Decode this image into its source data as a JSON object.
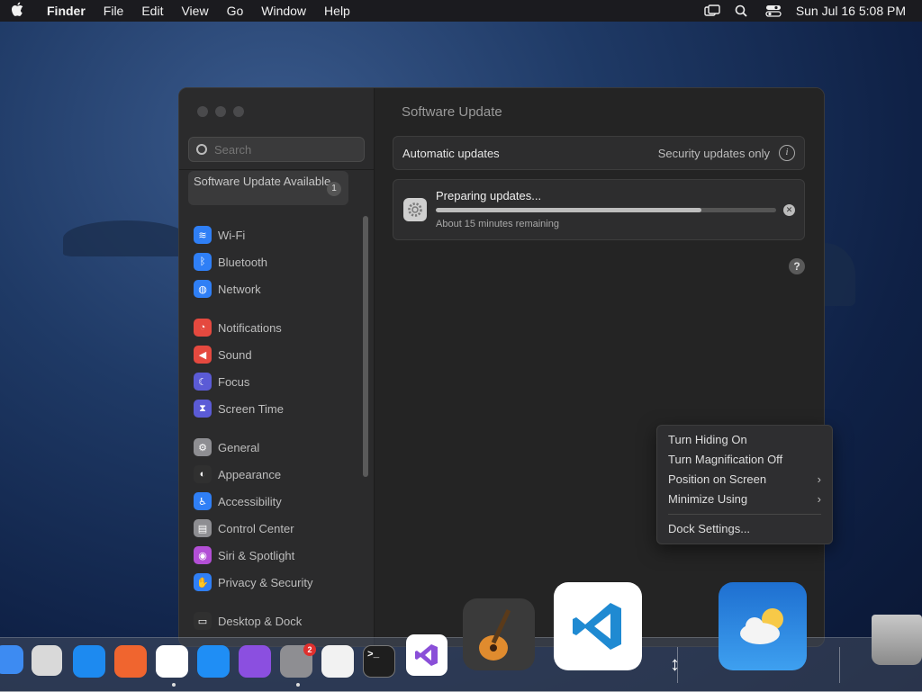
{
  "menubar": {
    "app_name": "Finder",
    "items": [
      "File",
      "Edit",
      "View",
      "Go",
      "Window",
      "Help"
    ],
    "datetime": "Sun Jul 16  5:08 PM",
    "icons": [
      "screen-mirroring-icon",
      "search-icon",
      "control-center-icon"
    ]
  },
  "settings": {
    "search_placeholder": "Search",
    "update_item": {
      "label": "Software Update Available",
      "badge": "1"
    },
    "sidebar": [
      {
        "label": "Wi-Fi",
        "icon": "wifi-icon",
        "color": "#2f7ff6",
        "glyph": "≋"
      },
      {
        "label": "Bluetooth",
        "icon": "bluetooth-icon",
        "color": "#2f7ff6",
        "glyph": "ᛒ"
      },
      {
        "label": "Network",
        "icon": "network-icon",
        "color": "#2f7ff6",
        "glyph": "◍"
      },
      {
        "label": "Notifications",
        "icon": "notifications-icon",
        "color": "#e5493f",
        "glyph": "◔"
      },
      {
        "label": "Sound",
        "icon": "sound-icon",
        "color": "#e5493f",
        "glyph": "◀"
      },
      {
        "label": "Focus",
        "icon": "focus-icon",
        "color": "#5b5bd6",
        "glyph": "☾"
      },
      {
        "label": "Screen Time",
        "icon": "screen-time-icon",
        "color": "#5b5bd6",
        "glyph": "⧗"
      },
      {
        "label": "General",
        "icon": "general-icon",
        "color": "#8e8e92",
        "glyph": "⚙"
      },
      {
        "label": "Appearance",
        "icon": "appearance-icon",
        "color": "#303030",
        "glyph": "◐"
      },
      {
        "label": "Accessibility",
        "icon": "accessibility-icon",
        "color": "#2f7ff6",
        "glyph": "♿"
      },
      {
        "label": "Control Center",
        "icon": "control-center-icon",
        "color": "#8e8e92",
        "glyph": "▤"
      },
      {
        "label": "Siri & Spotlight",
        "icon": "siri-icon",
        "color": "#b34fd6",
        "glyph": "◉"
      },
      {
        "label": "Privacy & Security",
        "icon": "privacy-hand-icon",
        "color": "#2f7ff6",
        "glyph": "✋"
      },
      {
        "label": "Desktop & Dock",
        "icon": "desktop-dock-icon",
        "color": "#303030",
        "glyph": "▭"
      }
    ],
    "title": "Software Update",
    "automatic_updates": {
      "label": "Automatic updates",
      "value": "Security updates only"
    },
    "preparing": {
      "title": "Preparing updates...",
      "subtitle": "About 15 minutes remaining",
      "progress": 0.78
    }
  },
  "context_menu": {
    "items": [
      {
        "label": "Turn Hiding On",
        "submenu": false
      },
      {
        "label": "Turn Magnification Off",
        "submenu": false
      },
      {
        "label": "Position on Screen",
        "submenu": true
      },
      {
        "label": "Minimize Using",
        "submenu": true
      }
    ],
    "footer_item": "Dock Settings..."
  },
  "dock": {
    "apps": [
      {
        "name": "Finder",
        "icon": "finder-icon",
        "color": "#3d8bf2"
      },
      {
        "name": "Launchpad",
        "icon": "launchpad-icon",
        "color": "#d9d9d9"
      },
      {
        "name": "Safari",
        "icon": "safari-icon",
        "color": "#1d8af0"
      },
      {
        "name": "Firefox",
        "icon": "firefox-icon",
        "color": "#f0652f"
      },
      {
        "name": "Chrome",
        "icon": "chrome-icon",
        "color": "#ffffff"
      },
      {
        "name": "App Store",
        "icon": "app-store-icon",
        "color": "#1f8ef5"
      },
      {
        "name": "Podcasts",
        "icon": "podcasts-icon",
        "color": "#8b4fe0"
      },
      {
        "name": "System Settings",
        "icon": "system-settings-icon",
        "color": "#8e8e92",
        "badge": "2"
      },
      {
        "name": "TextEdit",
        "icon": "textedit-icon",
        "color": "#f2f2f2"
      },
      {
        "name": "Terminal",
        "icon": "terminal-icon",
        "color": "#1e1e1e"
      },
      {
        "name": "Visual Studio",
        "icon": "visual-studio-icon",
        "color": "#ffffff"
      },
      {
        "name": "GarageBand",
        "icon": "garageband-icon",
        "color": "#3a3a3a"
      },
      {
        "name": "Visual Studio Code",
        "icon": "vscode-icon",
        "color": "#ffffff"
      },
      {
        "name": "Weather",
        "icon": "weather-icon",
        "color": "#2e86e6"
      },
      {
        "name": "Trash",
        "icon": "trash-icon",
        "color": "#9a9a9a"
      }
    ],
    "terminal_glyph": ">_"
  }
}
